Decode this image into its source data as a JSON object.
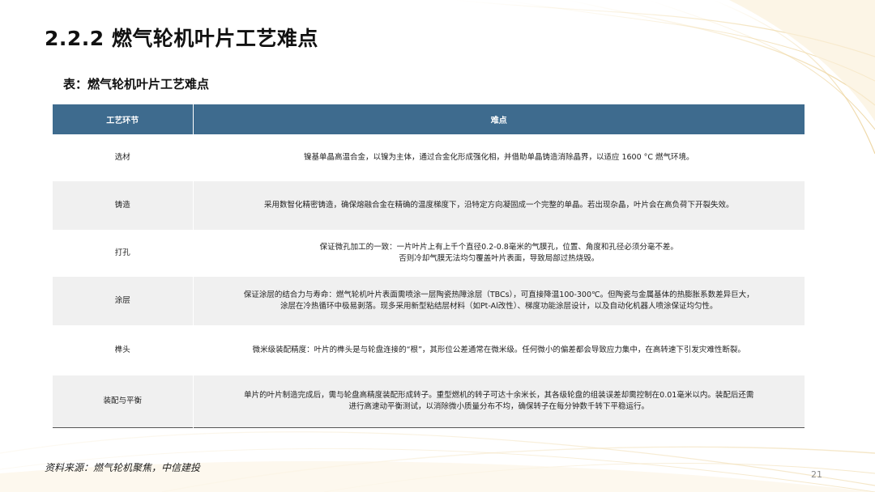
{
  "slide": {
    "title": "2.2.2 燃气轮机叶片工艺难点",
    "table_caption": "表：燃气轮机叶片工艺难点",
    "source": "资料来源：燃气轮机聚焦，中信建投",
    "page_number": "21"
  },
  "table": {
    "headers": [
      "工艺环节",
      "难点"
    ],
    "rows": [
      {
        "stage": "选材",
        "lines": [
          "镍基单晶高温合金，以镍为主体，通过合金化形成强化相，并借助单晶铸造消除晶界，以适应 1600 °C 燃气环境。"
        ]
      },
      {
        "stage": "铸造",
        "lines": [
          "采用数智化精密铸造，确保熔融合金在精确的温度梯度下，沿特定方向凝固成一个完整的单晶。若出现杂晶，叶片会在高负荷下开裂失效。"
        ]
      },
      {
        "stage": "打孔",
        "lines": [
          "保证微孔加工的一致：一片叶片上有上千个直径0.2-0.8毫米的气膜孔，位置、角度和孔径必须分毫不差。",
          "否则冷却气膜无法均匀覆盖叶片表面，导致局部过热烧毁。"
        ]
      },
      {
        "stage": "涂层",
        "lines": [
          "保证涂层的结合力与寿命：燃气轮机叶片表面需喷涂一层陶瓷热障涂层（TBCs），可直接降温100-300℃。但陶瓷与金属基体的热膨胀系数差异巨大，",
          "涂层在冷热循环中极易剥落。现多采用新型粘结层材料（如Pt-Al改性）、梯度功能涂层设计，以及自动化机器人喷涂保证均匀性。"
        ]
      },
      {
        "stage": "榫头",
        "lines": [
          "微米级装配精度：叶片的榫头是与轮盘连接的“根”，其形位公差通常在微米级。任何微小的偏差都会导致应力集中，在高转速下引发灾难性断裂。"
        ]
      },
      {
        "stage": "装配与平衡",
        "lines": [
          "单片的叶片制造完成后，需与轮盘高精度装配形成转子。重型燃机的转子可达十余米长，其各级轮盘的组装误差却需控制在0.01毫米以内。装配后还需",
          "进行高速动平衡测试，以消除微小质量分布不均，确保转子在每分钟数千转下平稳运行。"
        ]
      }
    ]
  }
}
